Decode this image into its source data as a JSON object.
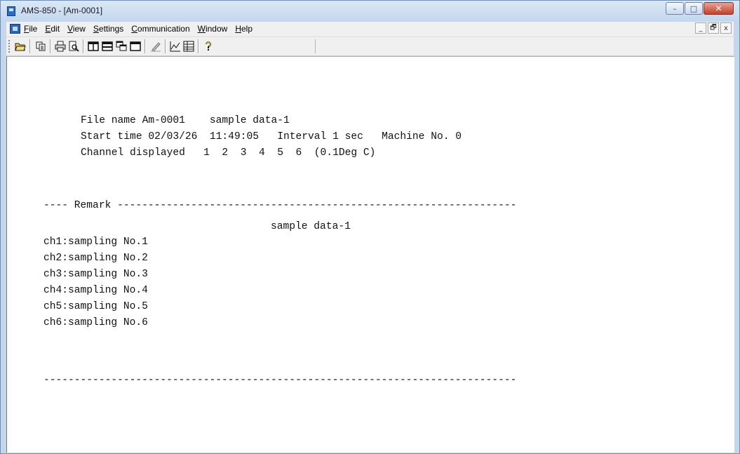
{
  "window": {
    "title": "AMS-850 - [Am-0001]"
  },
  "caption_buttons": {
    "minimize": "–",
    "maximize": "□",
    "close": "✕"
  },
  "menu": [
    {
      "label": "File",
      "u": "F",
      "rest": "ile"
    },
    {
      "label": "Edit",
      "u": "E",
      "rest": "dit"
    },
    {
      "label": "View",
      "u": "V",
      "rest": "iew"
    },
    {
      "label": "Settings",
      "u": "S",
      "rest": "ettings"
    },
    {
      "label": "Communication",
      "u": "C",
      "rest": "ommunication"
    },
    {
      "label": "Window",
      "u": "W",
      "rest": "indow"
    },
    {
      "label": "Help",
      "u": "H",
      "rest": "elp"
    }
  ],
  "mdi_buttons": {
    "minimize": "_",
    "restore": "🗗",
    "close": "x"
  },
  "toolbar_icons": [
    "open-folder-icon",
    "copy-icon",
    "print-icon",
    "print-preview-icon",
    "split-vertical-icon",
    "split-horizontal-icon",
    "cascade-windows-icon",
    "single-window-icon",
    "edit-pen-icon",
    "graph-icon",
    "table-icon",
    "help-icon"
  ],
  "document": {
    "lines": [
      "File name Am-0001    sample data-1",
      "Start time 02/03/26  11:49:05   Interval 1 sec   Machine No. 0",
      "Channel displayed   1  2  3  4  5  6  (0.1Deg C)",
      "---- Remark -----------------------------------------------------------------",
      "sample data-1",
      "ch1:sampling No.1",
      "ch2:sampling No.2",
      "ch3:sampling No.3",
      "ch4:sampling No.4",
      "ch5:sampling No.5",
      "ch6:sampling No.6",
      "-----------------------------------------------------------------------------"
    ]
  }
}
